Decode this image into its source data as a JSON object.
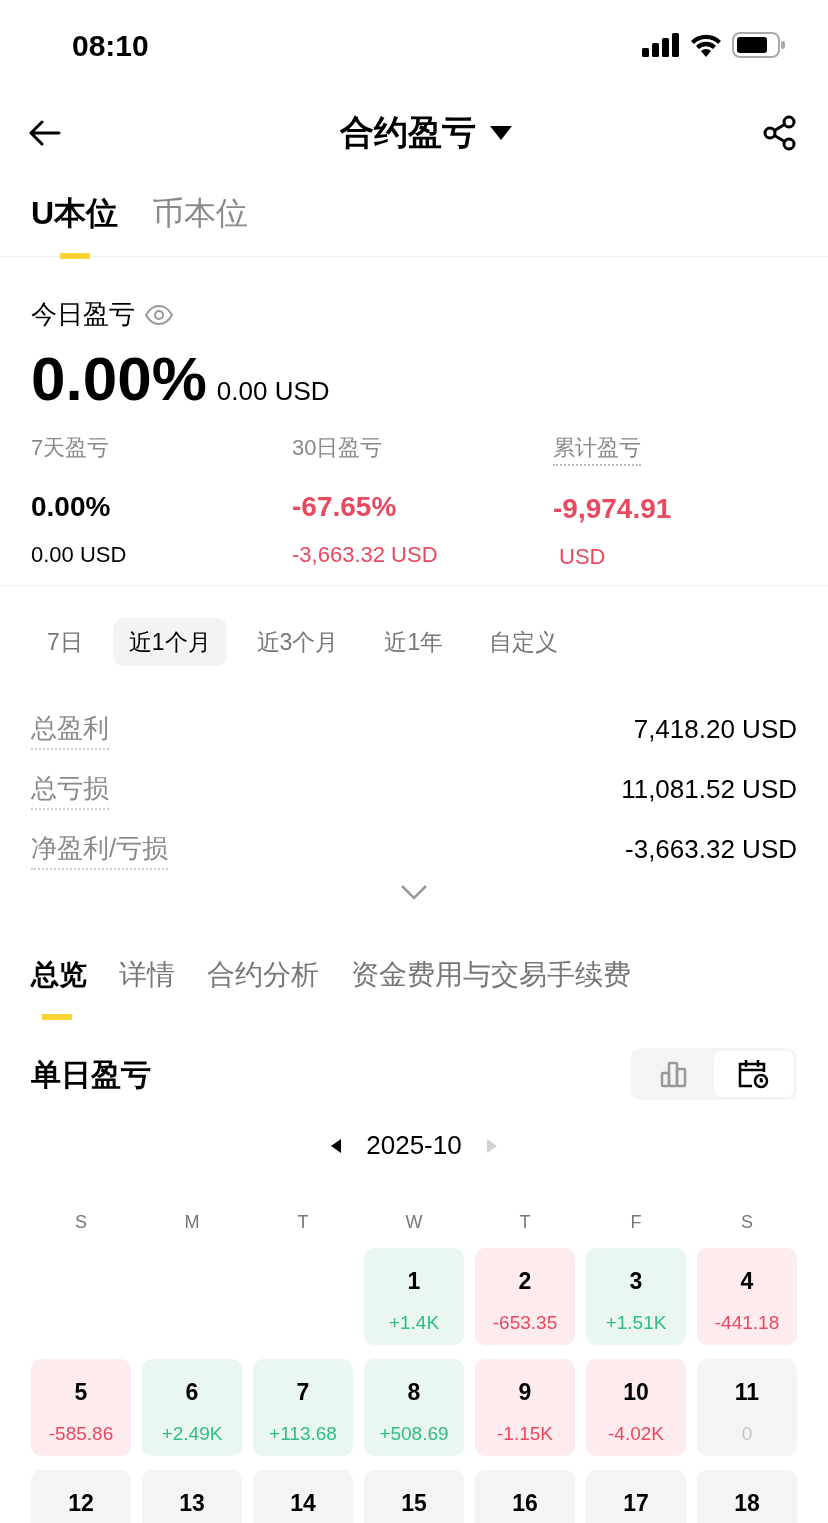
{
  "status_bar": {
    "time": "08:10"
  },
  "header": {
    "title": "合约盈亏"
  },
  "account_tabs": [
    {
      "label": "U本位",
      "selected": true
    },
    {
      "label": "币本位",
      "selected": false
    }
  ],
  "today": {
    "label": "今日盈亏",
    "percent": "0.00%",
    "amount": "0.00 USD"
  },
  "stats": [
    {
      "label": "7天盈亏",
      "value": "0.00%",
      "sub": "0.00 USD",
      "kind": "neutral",
      "dotted": false
    },
    {
      "label": "30日盈亏",
      "value": "-67.65%",
      "sub": "-3,663.32 USD",
      "kind": "loss",
      "dotted": false
    },
    {
      "label": "累计盈亏",
      "value": "-9,974.91",
      "sub": "USD",
      "kind": "loss",
      "dotted": true
    }
  ],
  "periods": [
    {
      "label": "7日",
      "selected": false
    },
    {
      "label": "近1个月",
      "selected": true
    },
    {
      "label": "近3个月",
      "selected": false
    },
    {
      "label": "近1年",
      "selected": false
    },
    {
      "label": "自定义",
      "selected": false
    }
  ],
  "summary": [
    {
      "label": "总盈利",
      "value": "7,418.20 USD"
    },
    {
      "label": "总亏损",
      "value": "11,081.52 USD"
    },
    {
      "label": "净盈利/亏损",
      "value": "-3,663.32 USD"
    }
  ],
  "section_tabs": [
    {
      "label": "总览",
      "selected": true
    },
    {
      "label": "详情",
      "selected": false
    },
    {
      "label": "合约分析",
      "selected": false
    },
    {
      "label": "资金费用与交易手续费",
      "selected": false
    }
  ],
  "daily": {
    "title": "单日盈亏",
    "views": [
      {
        "kind": "chart",
        "selected": false
      },
      {
        "kind": "calendar",
        "selected": true
      }
    ],
    "month": "2025-10",
    "prev_disabled": false,
    "next_disabled": true,
    "weekdays": [
      "S",
      "M",
      "T",
      "W",
      "T",
      "F",
      "S"
    ],
    "weeks": [
      [
        {
          "day": "1",
          "value": "+1.4K",
          "kind": "profit"
        },
        {
          "day": "2",
          "value": "-653.35",
          "kind": "loss"
        },
        {
          "day": "3",
          "value": "+1.51K",
          "kind": "profit"
        },
        {
          "day": "4",
          "value": "-441.18",
          "kind": "loss"
        }
      ],
      [
        {
          "day": "5",
          "value": "-585.86",
          "kind": "loss"
        },
        {
          "day": "6",
          "value": "+2.49K",
          "kind": "profit"
        },
        {
          "day": "7",
          "value": "+113.68",
          "kind": "profit"
        },
        {
          "day": "8",
          "value": "+508.69",
          "kind": "profit"
        },
        {
          "day": "9",
          "value": "-1.15K",
          "kind": "loss"
        },
        {
          "day": "10",
          "value": "-4.02K",
          "kind": "loss"
        },
        {
          "day": "11",
          "value": "0",
          "kind": "flat"
        }
      ],
      [
        {
          "day": "12",
          "kind": "flat"
        },
        {
          "day": "13",
          "kind": "flat"
        },
        {
          "day": "14",
          "kind": "flat"
        },
        {
          "day": "15",
          "kind": "flat"
        },
        {
          "day": "16",
          "kind": "flat"
        },
        {
          "day": "17",
          "kind": "flat"
        },
        {
          "day": "18",
          "kind": "flat"
        }
      ]
    ]
  }
}
